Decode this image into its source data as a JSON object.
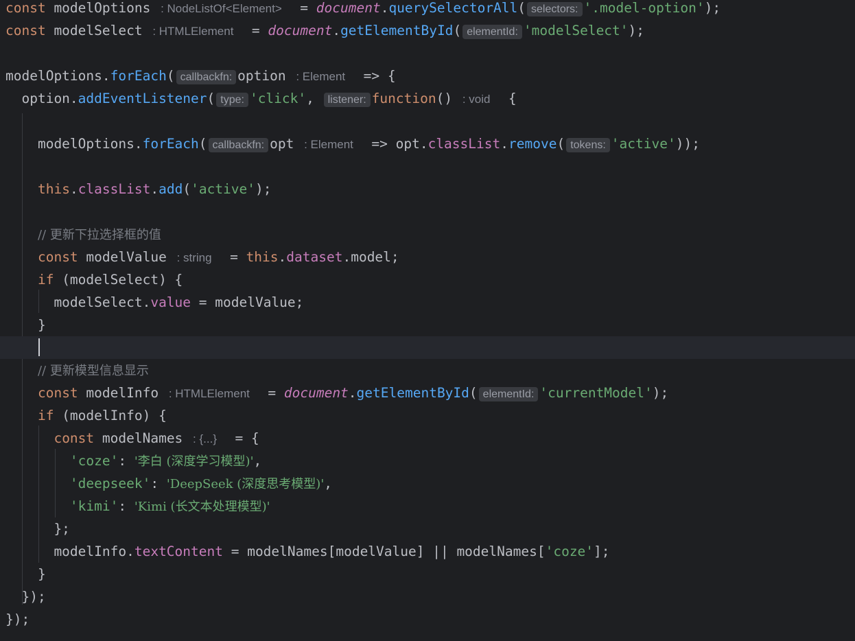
{
  "editor": {
    "language": "javascript",
    "theme_colors": {
      "background": "#1e1f22",
      "current_line": "#26282e",
      "keyword": "#cf8e6d",
      "function": "#56a8f5",
      "string": "#6aab73",
      "global_and_property": "#c77dbb",
      "comment": "#7a7e85",
      "inlay_hint": "#868993",
      "default_text": "#bcbec4"
    },
    "lines": [
      {
        "text": "const modelOptions",
        "hint": ": NodeListOf<Element>"
      },
      {
        "text": "const modelSelect",
        "hint": ": HTMLElement"
      },
      {
        "text": ""
      },
      {
        "text": "modelOptions.forEach(",
        "hint": "callbackfn:"
      },
      {
        "text": "option.addEventListener(",
        "hint": "type:"
      },
      {
        "text": ""
      },
      {
        "text": "modelOptions.forEach(",
        "hint": "callbackfn:"
      },
      {
        "text": ""
      },
      {
        "text": "this.classList.add('active');"
      },
      {
        "text": ""
      },
      {
        "text": "// 更新下拉选择框的值"
      },
      {
        "text": "const modelValue",
        "hint": ": string"
      },
      {
        "text": "if (modelSelect) {"
      },
      {
        "text": "modelSelect.value = modelValue;"
      },
      {
        "text": "}"
      },
      {
        "text": ""
      },
      {
        "text": "// 更新模型信息显示"
      },
      {
        "text": "const modelInfo",
        "hint": ": HTMLElement"
      },
      {
        "text": "if (modelInfo) {"
      },
      {
        "text": "const modelNames",
        "hint": ": {...}"
      },
      {
        "text": "'coze': '李白 (深度学习模型)',"
      },
      {
        "text": "'deepseek': 'DeepSeek (深度思考模型)',"
      },
      {
        "text": "'kimi': 'Kimi (长文本处理模型)'"
      },
      {
        "text": "};"
      },
      {
        "text": "modelInfo.textContent = modelNames[modelValue] || modelNames['coze'];"
      },
      {
        "text": "}"
      },
      {
        "text": "});"
      },
      {
        "text": "});"
      }
    ],
    "hints": {
      "h1": ": NodeListOf<Element>",
      "h2": ": HTMLElement",
      "h3": ": Element",
      "h4": ": void",
      "h5": ": Element",
      "h6": ": string",
      "h7": ": HTMLElement",
      "h8": ": {...}",
      "p_selectors": "selectors:",
      "p_elementId": "elementId:",
      "p_callbackfn": "callbackfn:",
      "p_type": "type:",
      "p_listener": "listener:",
      "p_tokens": "tokens:"
    },
    "strings": {
      "s_model_option": "'.model-option'",
      "s_modelSelect": "'modelSelect'",
      "s_click": "'click'",
      "s_active": "'active'",
      "s_currentModel": "'currentModel'",
      "s_coze_key": "'coze'",
      "s_coze_val_open": "'李白 (深度学习模型)'",
      "s_deepseek_key": "'deepseek'",
      "s_deepseek_val": "'DeepSeek (深度思考模型)'",
      "s_kimi_key": "'kimi'",
      "s_kimi_val": "'Kimi (长文本处理模型)'"
    },
    "comments": {
      "c1": "// 更新下拉选择框的值",
      "c2": "// 更新模型信息显示"
    }
  }
}
